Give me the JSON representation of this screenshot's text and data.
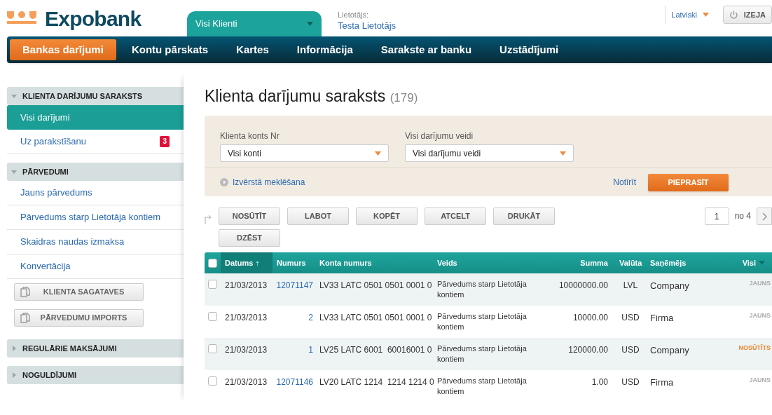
{
  "header": {
    "logo": "Expobank",
    "client_tab": "Visi Klienti",
    "user_label": "Lietotājs:",
    "user_name": "Testa Lietotājs",
    "language": "Latviski",
    "logout": "IZEJA"
  },
  "nav": [
    {
      "label": "Bankas darījumi",
      "selected": true
    },
    {
      "label": "Kontu pārskats",
      "selected": false
    },
    {
      "label": "Kartes",
      "selected": false
    },
    {
      "label": "Informācija",
      "selected": false
    },
    {
      "label": "Sarakste ar banku",
      "selected": false
    },
    {
      "label": "Uzstādījumi",
      "selected": false
    }
  ],
  "sidebar": [
    {
      "kind": "section",
      "title": "KLIENTA DARĪJUMU SARAKSTS",
      "expanded": true,
      "items": [
        {
          "label": "Visi darījumi",
          "selected": true
        },
        {
          "label": "Uz parakstīšanu",
          "selected": false,
          "badge": "3"
        }
      ]
    },
    {
      "kind": "section",
      "title": "PĀRVEDUMI",
      "expanded": true,
      "items": [
        {
          "label": "Jauns pārvedums",
          "selected": false
        },
        {
          "label": "Pārvedums starp Lietotāja kontiem",
          "selected": false
        },
        {
          "label": "Skaidras naudas izmaksa",
          "selected": false
        },
        {
          "label": "Konvertācija",
          "selected": false
        }
      ]
    },
    {
      "kind": "button",
      "label": "KLIENTA SAGATAVES"
    },
    {
      "kind": "button",
      "label": "PĀRVEDUMU IMPORTS"
    },
    {
      "kind": "section",
      "title": "REGULĀRIE MAKSĀJUMI",
      "expanded": false
    },
    {
      "kind": "section",
      "title": "NOGULDĪJUMI",
      "expanded": false
    }
  ],
  "page": {
    "title": "Klienta darījumu saraksts",
    "count": "(179)"
  },
  "filters": {
    "fields": [
      {
        "label": "Klienta konts Nr",
        "value": "Visi konti"
      },
      {
        "label": "Visi darījumu veidi",
        "value": "Visi darījumu veidi"
      }
    ],
    "advanced": "Izvērstā meklēšana",
    "clear": "Notīrīt",
    "submit": "PIEPRASĪT"
  },
  "actions": [
    "NOSŪTĪT",
    "LABOT",
    "KOPĒT",
    "ATCELT",
    "DRUKĀT",
    "DZĒST"
  ],
  "pager": {
    "page": "1",
    "of": "no 4"
  },
  "table": {
    "columns": [
      "Datums",
      "Numurs",
      "Konta numurs",
      "Veids",
      "Summa",
      "Valūta",
      "Saņēmējs",
      "Visi"
    ],
    "all_checked": false,
    "rows": [
      {
        "checked": false,
        "date": "21/03/2013",
        "number": "12071147",
        "account": "LV33 LATC 0501 0501 0001 0",
        "type": "Pārvedums starp Lietotāja kontiem",
        "amount": "10000000.00",
        "currency": "LVL",
        "payee": "Company",
        "status": "JAUNS",
        "color": "#aaaaaa"
      },
      {
        "checked": false,
        "date": "21/03/2013",
        "number": "2",
        "account": "LV33 LATC 0501 0501 0001 0",
        "type": "Pārvedums starp Lietotāja kontiem",
        "amount": "10000.00",
        "currency": "USD",
        "payee": "Firma",
        "status": "JAUNS",
        "color": "#aaaaaa"
      },
      {
        "checked": false,
        "date": "21/03/2013",
        "number": "1",
        "account": "LV25 LATC 6001  60016001 0",
        "type": "Pārvedums starp Lietotāja kontiem",
        "amount": "120000.00",
        "currency": "USD",
        "payee": "Company",
        "status": "NOSŪTĪTS",
        "color": "#e8862a"
      },
      {
        "checked": false,
        "date": "21/03/2013",
        "number": "12071146",
        "account": "LV20 LATC 1214  1214 1214 0",
        "type": "Pārvedums starp Lietotāja kontiem",
        "amount": "1.00",
        "currency": "USD",
        "payee": "Firma",
        "status": "JAUNS",
        "color": "#aaaaaa"
      }
    ]
  }
}
